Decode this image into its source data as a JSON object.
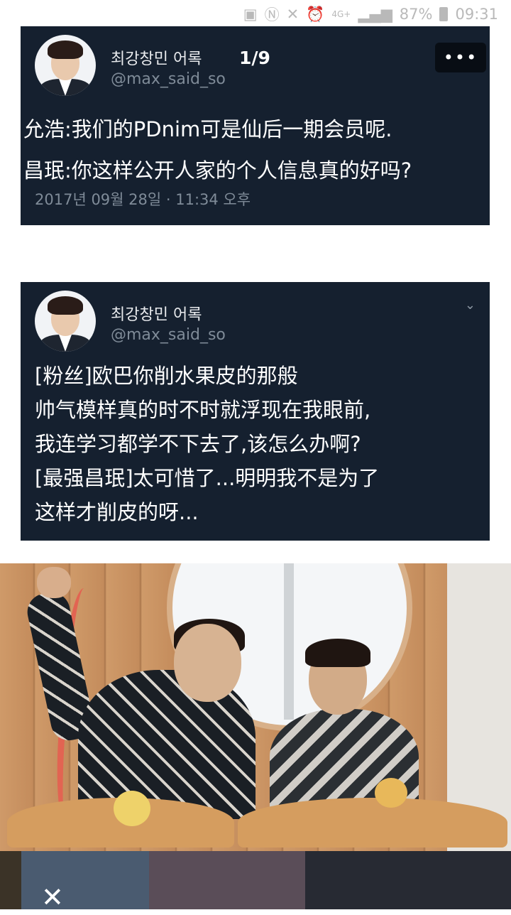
{
  "status_bar": {
    "signal_label": "4G+",
    "battery": "87%",
    "time": "09:31"
  },
  "card1": {
    "display_name": "최강창민 어록",
    "handle": "@max_said_so",
    "counter": "1/9",
    "more_label": "•••",
    "lines": [
      "允浩:我们的PDnim可是仙后一期会员呢.",
      "昌珉:你这样公开人家的个人信息真的好吗?"
    ],
    "date": "2017년 09월 28일 · 11:34 오후"
  },
  "card2": {
    "display_name": "최강창민 어록",
    "handle": "@max_said_so",
    "lines": [
      "[粉丝]欧巴你削水果皮的那般",
      "帅气模样真的时不时就浮现在我眼前,",
      "我连学习都学不下去了,该怎么办啊?",
      "[最强昌珉]太可惜了...明明我不是为了",
      "这样才削皮的呀..."
    ]
  },
  "icons": {
    "chevron": "⌄",
    "close": "✕"
  }
}
